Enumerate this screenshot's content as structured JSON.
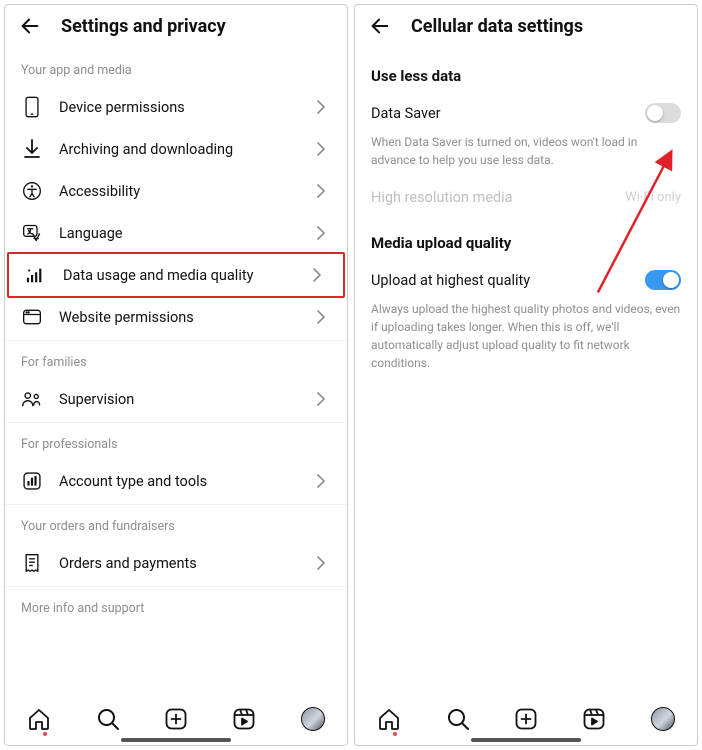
{
  "left": {
    "title": "Settings and privacy",
    "sections": {
      "app_media": {
        "label": "Your app and media",
        "items": [
          {
            "label": "Device permissions"
          },
          {
            "label": "Archiving and downloading"
          },
          {
            "label": "Accessibility"
          },
          {
            "label": "Language"
          },
          {
            "label": "Data usage and media quality"
          },
          {
            "label": "Website permissions"
          }
        ]
      },
      "families": {
        "label": "For families",
        "items": [
          {
            "label": "Supervision"
          }
        ]
      },
      "professionals": {
        "label": "For professionals",
        "items": [
          {
            "label": "Account type and tools"
          }
        ]
      },
      "orders": {
        "label": "Your orders and fundraisers",
        "items": [
          {
            "label": "Orders and payments"
          }
        ]
      },
      "more": {
        "label": "More info and support"
      }
    }
  },
  "right": {
    "title": "Cellular data settings",
    "use_less": {
      "heading": "Use less data",
      "data_saver_label": "Data Saver",
      "data_saver_desc": "When Data Saver is turned on, videos won't load in advance to help you use less data.",
      "high_res_label": "High resolution media",
      "high_res_value": "Wi-Fi only"
    },
    "upload": {
      "heading": "Media upload quality",
      "upload_hq_label": "Upload at highest quality",
      "upload_hq_desc": "Always upload the highest quality photos and videos, even if uploading takes longer. When this is off, we'll automatically adjust upload quality to fit network conditions."
    }
  }
}
